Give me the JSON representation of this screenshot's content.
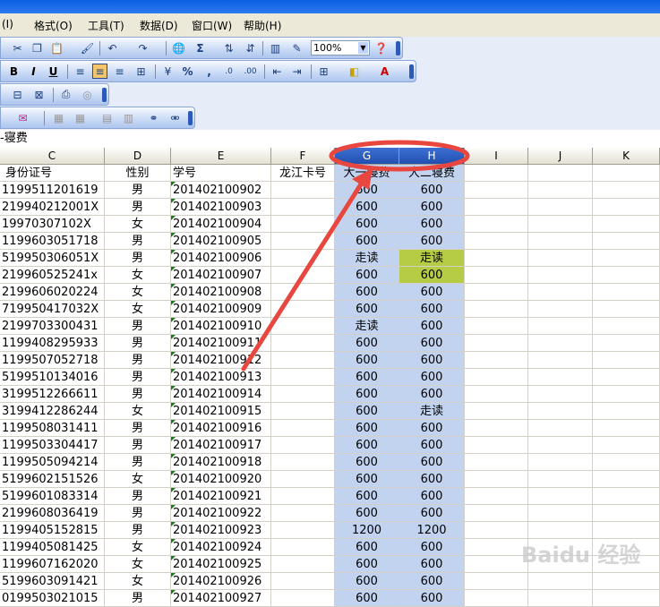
{
  "menu": {
    "items": [
      "(I)",
      "格式(O)",
      "工具(T)",
      "数据(D)",
      "窗口(W)",
      "帮助(H)"
    ]
  },
  "toolbar": {
    "zoom_value": "100%",
    "bold": "B",
    "italic": "I",
    "underline": "U",
    "percent": "%",
    "comma": ",",
    "sigma": "Σ"
  },
  "formula_bar": {
    "content": "-寝费"
  },
  "columns": [
    "C",
    "D",
    "E",
    "F",
    "G",
    "H",
    "I",
    "J",
    "K"
  ],
  "header_row": [
    "身份证号",
    "性别",
    "学号",
    "龙江卡号",
    "大一寝费",
    "大二寝费"
  ],
  "rows": [
    [
      "1199511201619",
      "男",
      "201402100902",
      "",
      "600",
      "600"
    ],
    [
      "219940212001X",
      "男",
      "201402100903",
      "",
      "600",
      "600"
    ],
    [
      "19970307102X",
      "女",
      "201402100904",
      "",
      "600",
      "600"
    ],
    [
      "1199603051718",
      "男",
      "201402100905",
      "",
      "600",
      "600"
    ],
    [
      "519950306051X",
      "男",
      "201402100906",
      "",
      "走读",
      "走读"
    ],
    [
      "219960525241x",
      "女",
      "201402100907",
      "",
      "600",
      "600"
    ],
    [
      "2199606020224",
      "女",
      "201402100908",
      "",
      "600",
      "600"
    ],
    [
      "719950417032X",
      "女",
      "201402100909",
      "",
      "600",
      "600"
    ],
    [
      "2199703300431",
      "男",
      "201402100910",
      "",
      "走读",
      "600"
    ],
    [
      "1199408295933",
      "男",
      "201402100911",
      "",
      "600",
      "600"
    ],
    [
      "1199507052718",
      "男",
      "201402100912",
      "",
      "600",
      "600"
    ],
    [
      "5199510134016",
      "男",
      "201402100913",
      "",
      "600",
      "600"
    ],
    [
      "3199512266611",
      "男",
      "201402100914",
      "",
      "600",
      "600"
    ],
    [
      "3199412286244",
      "女",
      "201402100915",
      "",
      "600",
      "走读"
    ],
    [
      "1199508031411",
      "男",
      "201402100916",
      "",
      "600",
      "600"
    ],
    [
      "1199503304417",
      "男",
      "201402100917",
      "",
      "600",
      "600"
    ],
    [
      "1199505094214",
      "男",
      "201402100918",
      "",
      "600",
      "600"
    ],
    [
      "5199602151526",
      "女",
      "201402100920",
      "",
      "600",
      "600"
    ],
    [
      "5199601083314",
      "男",
      "201402100921",
      "",
      "600",
      "600"
    ],
    [
      "2199608036419",
      "男",
      "201402100922",
      "",
      "600",
      "600"
    ],
    [
      "1199405152815",
      "男",
      "201402100923",
      "",
      "1200",
      "1200"
    ],
    [
      "1199405081425",
      "女",
      "201402100924",
      "",
      "600",
      "600"
    ],
    [
      "1199607162020",
      "女",
      "201402100925",
      "",
      "600",
      "600"
    ],
    [
      "5199603091421",
      "女",
      "201402100926",
      "",
      "600",
      "600"
    ],
    [
      "0199503021015",
      "男",
      "201402100927",
      "",
      "600",
      "600"
    ]
  ],
  "highlight_colors": {
    "selection": "#c2d3f0",
    "green_fill": "#b6cc44",
    "annotation_red": "#e8473f"
  },
  "watermark": "Baidu 经验"
}
